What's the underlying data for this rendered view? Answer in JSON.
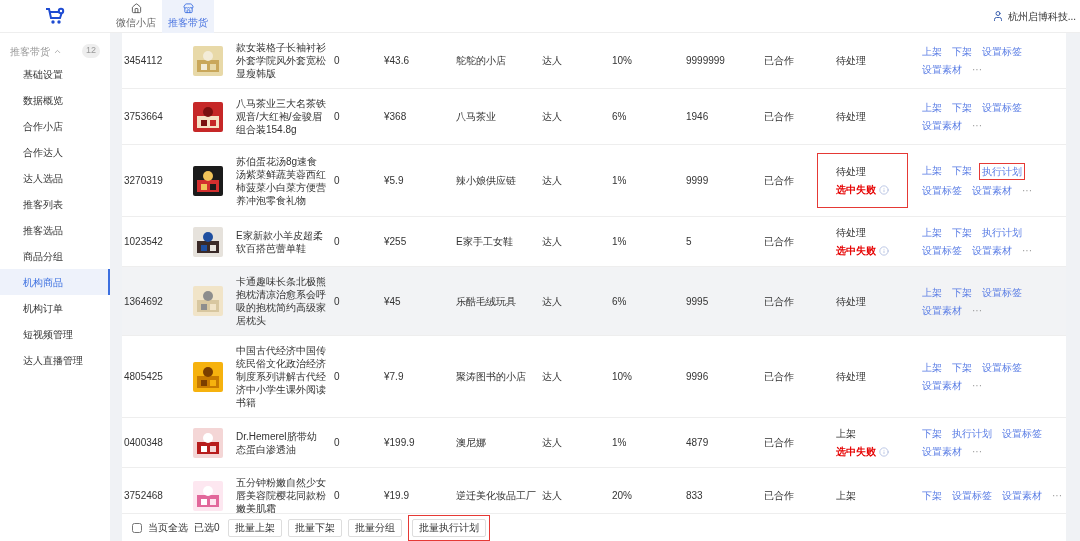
{
  "top_nav": {
    "tabs": [
      {
        "label": "微信小店",
        "selected": false
      },
      {
        "label": "推客带货",
        "selected": true
      }
    ],
    "user": "杭州启博科技..."
  },
  "sidebar": {
    "group": {
      "label": "推客带货",
      "count": "12",
      "expanded": true
    },
    "items": [
      {
        "label": "基础设置",
        "selected": false
      },
      {
        "label": "数据概览",
        "selected": false
      },
      {
        "label": "合作小店",
        "selected": false
      },
      {
        "label": "合作达人",
        "selected": false
      },
      {
        "label": "达人选品",
        "selected": false
      },
      {
        "label": "推客列表",
        "selected": false
      },
      {
        "label": "推客选品",
        "selected": false
      },
      {
        "label": "商品分组",
        "selected": false
      },
      {
        "label": "机构商品",
        "selected": true
      },
      {
        "label": "机构订单",
        "selected": false
      },
      {
        "label": "短视频管理",
        "selected": false
      },
      {
        "label": "达人直播管理",
        "selected": false
      }
    ]
  },
  "table": {
    "rows": [
      {
        "id": "3454112",
        "name": "款女装格子长袖衬衫外套学院风外套宽松显瘦韩版",
        "qty": "0",
        "price": "¥43.6",
        "shop": "鸵鸵的小店",
        "type": "达人",
        "rate": "10%",
        "sales": "9999999",
        "coop": "已合作",
        "status": "待处理",
        "failure": null,
        "status_highlighted": false,
        "hover": false,
        "actions": [
          {
            "label": "上架",
            "highlighted": false
          },
          {
            "label": "下架",
            "highlighted": false
          },
          {
            "label": "设置标签",
            "highlighted": false
          },
          {
            "label": "设置素材",
            "highlighted": false
          }
        ],
        "more": "···"
      },
      {
        "id": "3753664",
        "name": "八马茶业三大名茶铁观音/大红袍/金骏眉组合装154.8g",
        "qty": "0",
        "price": "¥368",
        "shop": "八马茶业",
        "type": "达人",
        "rate": "6%",
        "sales": "1946",
        "coop": "已合作",
        "status": "待处理",
        "failure": null,
        "status_highlighted": false,
        "hover": false,
        "actions": [
          {
            "label": "上架",
            "highlighted": false
          },
          {
            "label": "下架",
            "highlighted": false
          },
          {
            "label": "设置标签",
            "highlighted": false
          },
          {
            "label": "设置素材",
            "highlighted": false
          }
        ],
        "more": "···"
      },
      {
        "id": "3270319",
        "name": "苏伯蛋花汤8g速食汤紫菜鲜蔬芙蓉西红柿菠菜小白菜方便营养冲泡零食礼物",
        "qty": "0",
        "price": "¥5.9",
        "shop": "辣小娘供应链",
        "type": "达人",
        "rate": "1%",
        "sales": "9999",
        "coop": "已合作",
        "status": "待处理",
        "failure": "选中失败",
        "status_highlighted": true,
        "hover": false,
        "actions": [
          {
            "label": "上架",
            "highlighted": false
          },
          {
            "label": "下架",
            "highlighted": false
          },
          {
            "label": "执行计划",
            "highlighted": true
          },
          {
            "label": "设置标签",
            "highlighted": false
          },
          {
            "label": "设置素材",
            "highlighted": false
          }
        ],
        "more": "···"
      },
      {
        "id": "1023542",
        "name": "E家新款小羊皮超柔软百搭芭蕾单鞋",
        "qty": "0",
        "price": "¥255",
        "shop": "E家手工女鞋",
        "type": "达人",
        "rate": "1%",
        "sales": "5",
        "coop": "已合作",
        "status": "待处理",
        "failure": "选中失败",
        "status_highlighted": false,
        "hover": false,
        "actions": [
          {
            "label": "上架",
            "highlighted": false
          },
          {
            "label": "下架",
            "highlighted": false
          },
          {
            "label": "执行计划",
            "highlighted": false
          },
          {
            "label": "设置标签",
            "highlighted": false
          },
          {
            "label": "设置素材",
            "highlighted": false
          }
        ],
        "more": "···"
      },
      {
        "id": "1364692",
        "name": "卡通趣味长条北极熊抱枕清凉治愈系会呼吸的抱枕简约高级家居枕头",
        "qty": "0",
        "price": "¥45",
        "shop": "乐酷毛绒玩具",
        "type": "达人",
        "rate": "6%",
        "sales": "9995",
        "coop": "已合作",
        "status": "待处理",
        "failure": null,
        "status_highlighted": false,
        "hover": true,
        "actions": [
          {
            "label": "上架",
            "highlighted": false
          },
          {
            "label": "下架",
            "highlighted": false
          },
          {
            "label": "设置标签",
            "highlighted": false
          },
          {
            "label": "设置素材",
            "highlighted": false
          }
        ],
        "more": "···"
      },
      {
        "id": "4805425",
        "name": "中国古代经济中国传统民俗文化政治经济制度系列讲解古代经济中小学生课外阅读书籍",
        "qty": "0",
        "price": "¥7.9",
        "shop": "聚涛图书的小店",
        "type": "达人",
        "rate": "10%",
        "sales": "9996",
        "coop": "已合作",
        "status": "待处理",
        "failure": null,
        "status_highlighted": false,
        "hover": false,
        "actions": [
          {
            "label": "上架",
            "highlighted": false
          },
          {
            "label": "下架",
            "highlighted": false
          },
          {
            "label": "设置标签",
            "highlighted": false
          },
          {
            "label": "设置素材",
            "highlighted": false
          }
        ],
        "more": "···"
      },
      {
        "id": "0400348",
        "name": "Dr.Hemerel脐带幼态蛋白渗透油",
        "qty": "0",
        "price": "¥199.9",
        "shop": "澳尼娜",
        "type": "达人",
        "rate": "1%",
        "sales": "4879",
        "coop": "已合作",
        "status": "上架",
        "failure": "选中失败",
        "status_highlighted": false,
        "hover": false,
        "actions": [
          {
            "label": "下架",
            "highlighted": false
          },
          {
            "label": "执行计划",
            "highlighted": false
          },
          {
            "label": "设置标签",
            "highlighted": false
          },
          {
            "label": "设置素材",
            "highlighted": false
          }
        ],
        "more": "···"
      },
      {
        "id": "3752468",
        "name": "五分钟粉嫩自然少女唇美容院樱花同款粉嫩美肌霜",
        "qty": "0",
        "price": "¥19.9",
        "shop": "逆迁美化妆品工厂",
        "type": "达人",
        "rate": "20%",
        "sales": "833",
        "coop": "已合作",
        "status": "上架",
        "failure": null,
        "status_highlighted": false,
        "hover": false,
        "actions": [
          {
            "label": "下架",
            "highlighted": false
          },
          {
            "label": "设置标签",
            "highlighted": false
          },
          {
            "label": "设置素材",
            "highlighted": false
          }
        ],
        "more": "···"
      }
    ]
  },
  "bulk_bar": {
    "select_all": {
      "label": "当页全选",
      "checked": false
    },
    "selected_count": "已选0",
    "buttons": [
      {
        "label": "批量上架",
        "highlighted": false
      },
      {
        "label": "批量下架",
        "highlighted": false
      },
      {
        "label": "批量分组",
        "highlighted": false
      },
      {
        "label": "批量执行计划",
        "highlighted": true
      }
    ]
  }
}
